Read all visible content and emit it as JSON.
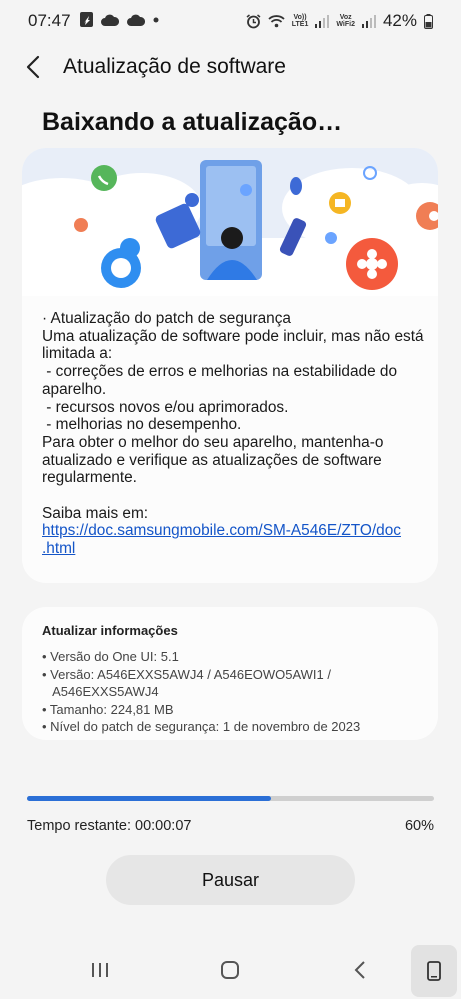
{
  "status_bar": {
    "time": "07:47",
    "volte_tag_1": "Vo))",
    "volte_tag_2": "LTE1",
    "vowifi_tag_1": "Voz",
    "vowifi_tag_2": "WiFi2",
    "battery": "42%"
  },
  "header": {
    "title": "Atualização de software"
  },
  "heading": "Baixando a atualização…",
  "main_card": {
    "lines": [
      "· Atualização do patch de segurança",
      "Uma atualização de software pode incluir, mas não está",
      "limitada a:",
      " - correções de erros e melhorias na estabilidade do",
      "aparelho.",
      " - recursos novos e/ou aprimorados.",
      " - melhorias no desempenho.",
      "Para obter o melhor do seu aparelho, mantenha-o",
      "atualizado e verifique as atualizações de software",
      "regularmente.",
      "",
      "Saiba mais em:"
    ],
    "link_line_1": "https://doc.samsungmobile.com/SM-A546E/ZTO/doc",
    "link_line_2": ".html"
  },
  "info_card": {
    "title": "Atualizar informações",
    "lines": [
      "• Versão do One UI: 5.1",
      "• Versão: A546EXXS5AWJ4 / A546EOWO5AWI1 /",
      "   A546EXXS5AWJ4",
      "• Tamanho: 224,81 MB",
      "• Nível do patch de segurança: 1 de novembro de 2023"
    ]
  },
  "progress": {
    "fraction": 0.6,
    "remaining_label": "Tempo restante: 00:00:07",
    "percent_label": "60%",
    "fill_color": "#2b6fd6"
  },
  "actions": {
    "pause_label": "Pausar"
  },
  "navbar": {
    "icons": [
      "recent-apps-icon",
      "home-icon",
      "back-icon",
      "phone-icon"
    ]
  }
}
